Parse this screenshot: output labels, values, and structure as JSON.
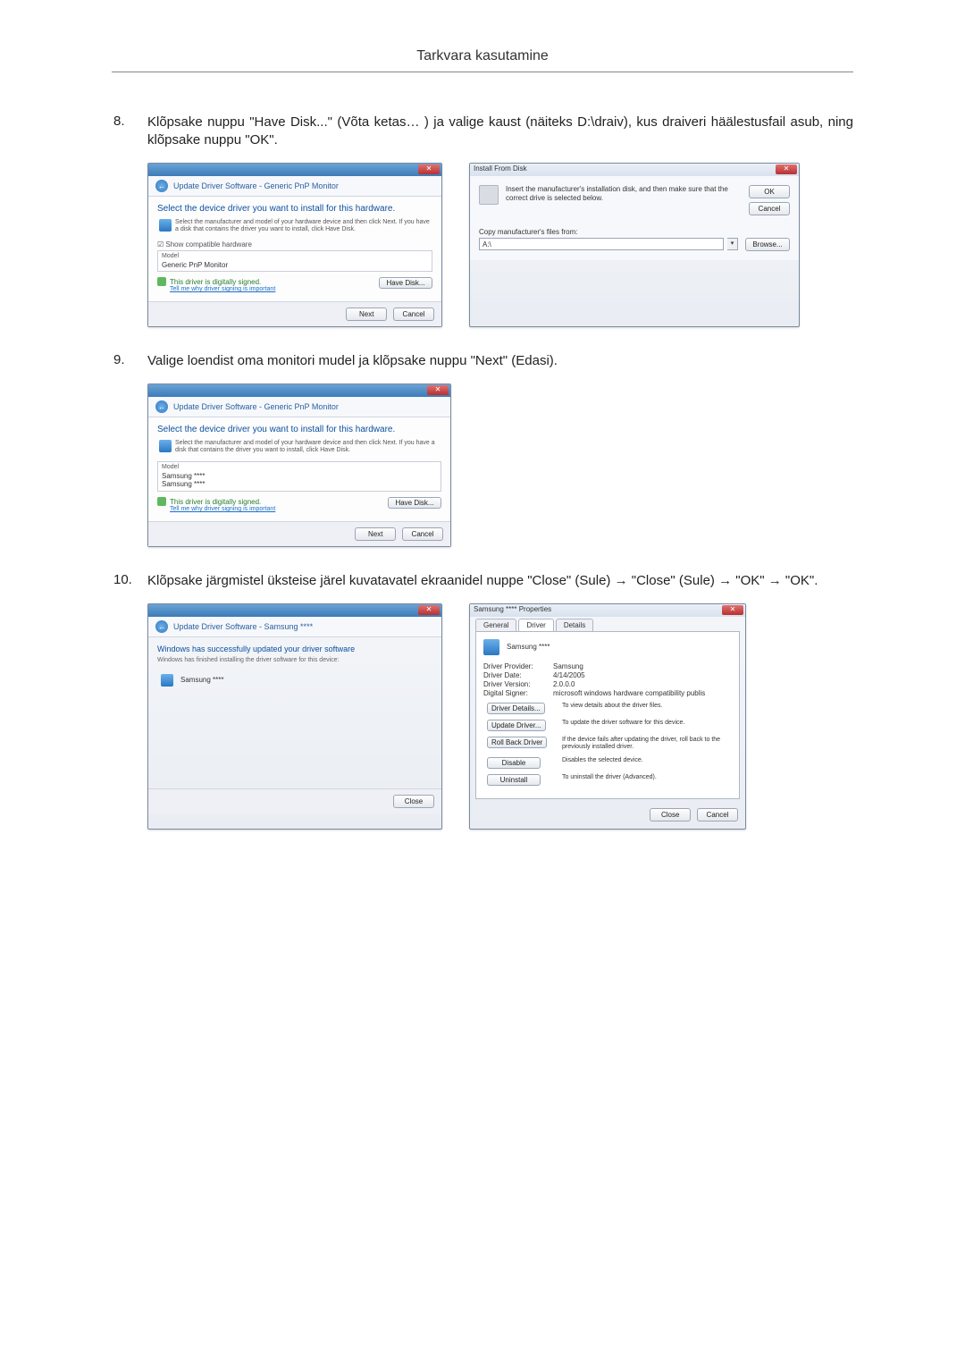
{
  "header": {
    "title": "Tarkvara kasutamine"
  },
  "steps": {
    "s8": {
      "num": "8.",
      "text": "Klõpsake nuppu \"Have Disk...\" (Võta ketas… ) ja valige kaust (näiteks D:\\draiv), kus draiveri häälestusfail asub, ning klõpsake nuppu \"OK\"."
    },
    "s9": {
      "num": "9.",
      "text": "Valige loendist oma monitori mudel ja klõpsake nuppu \"Next\" (Edasi)."
    },
    "s10": {
      "num": "10.",
      "text": "Klõpsake järgmistel üksteise järel kuvatavatel ekraanidel nuppe \"Close\" (Sule) → \"Close\" (Sule) → \"OK\" → \"OK\"."
    }
  },
  "dlg8a": {
    "crumb": "Update Driver Software - Generic PnP Monitor",
    "heading": "Select the device driver you want to install for this hardware.",
    "subtext": "Select the manufacturer and model of your hardware device and then click Next. If you have a disk that contains the driver you want to install, click Have Disk.",
    "chk": "☑ Show compatible hardware",
    "list_hdr": "Model",
    "list_item": "Generic PnP Monitor",
    "signed": "This driver is digitally signed.",
    "tellme": "Tell me why driver signing is important",
    "havedisk": "Have Disk...",
    "next": "Next",
    "cancel": "Cancel"
  },
  "dlg8b": {
    "title": "Install From Disk",
    "txt": "Insert the manufacturer's installation disk, and then make sure that the correct drive is selected below.",
    "ok": "OK",
    "cancel": "Cancel",
    "copylabel": "Copy manufacturer's files from:",
    "path": "A:\\",
    "browse": "Browse..."
  },
  "dlg9": {
    "crumb": "Update Driver Software - Generic PnP Monitor",
    "heading": "Select the device driver you want to install for this hardware.",
    "subtext": "Select the manufacturer and model of your hardware device and then click Next. If you have a disk that contains the driver you want to install, click Have Disk.",
    "list_hdr": "Model",
    "list_item1": "Samsung ****",
    "list_item2": "Samsung ****",
    "signed": "This driver is digitally signed.",
    "tellme": "Tell me why driver signing is important",
    "havedisk": "Have Disk...",
    "next": "Next",
    "cancel": "Cancel"
  },
  "dlg10a": {
    "crumb": "Update Driver Software - Samsung ****",
    "heading": "Windows has successfully updated your driver software",
    "sub": "Windows has finished installing the driver software for this device:",
    "item": "Samsung ****",
    "close": "Close"
  },
  "dlg10b": {
    "title": "Samsung **** Properties",
    "tabs": {
      "general": "General",
      "driver": "Driver",
      "details": "Details"
    },
    "device": "Samsung ****",
    "kv": {
      "provider_k": "Driver Provider:",
      "provider_v": "Samsung",
      "date_k": "Driver Date:",
      "date_v": "4/14/2005",
      "ver_k": "Driver Version:",
      "ver_v": "2.0.0.0",
      "signer_k": "Digital Signer:",
      "signer_v": "microsoft windows hardware compatibility publis"
    },
    "btns": {
      "details": "Driver Details...",
      "details_d": "To view details about the driver files.",
      "update": "Update Driver...",
      "update_d": "To update the driver software for this device.",
      "roll": "Roll Back Driver",
      "roll_d": "If the device fails after updating the driver, roll back to the previously installed driver.",
      "disable": "Disable",
      "disable_d": "Disables the selected device.",
      "uninstall": "Uninstall",
      "uninstall_d": "To uninstall the driver (Advanced)."
    },
    "close": "Close",
    "cancel": "Cancel"
  }
}
